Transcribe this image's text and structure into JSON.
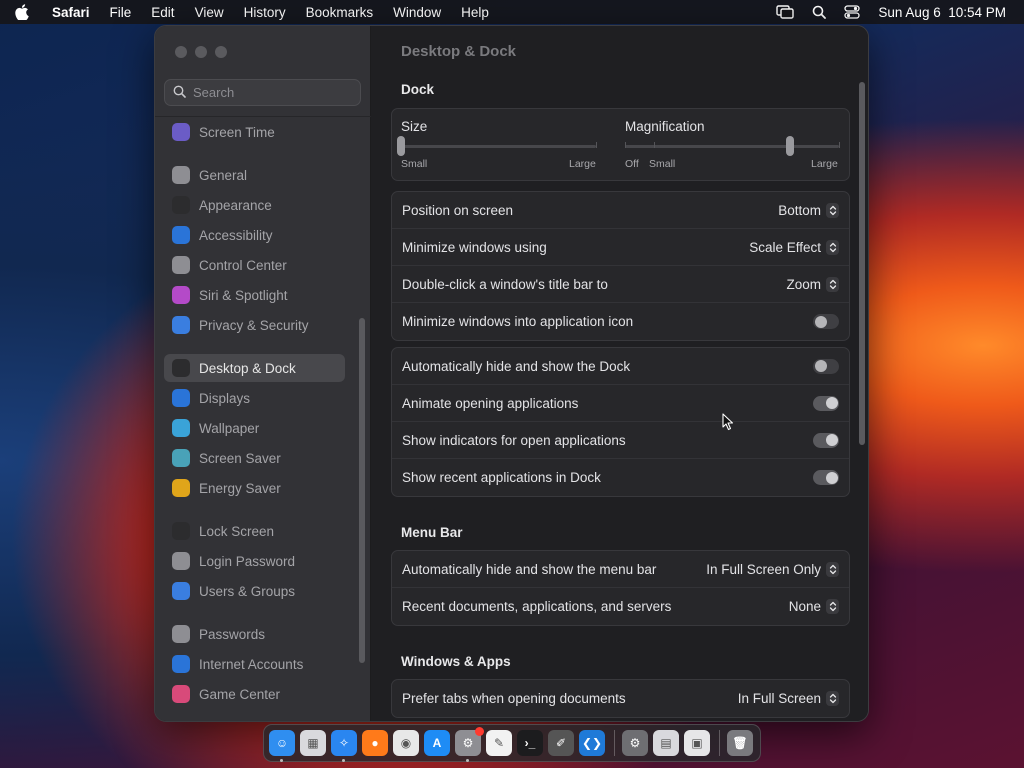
{
  "menubar": {
    "app_name": "Safari",
    "items": [
      "File",
      "Edit",
      "View",
      "History",
      "Bookmarks",
      "Window",
      "Help"
    ],
    "datetime": "Sun Aug 6  10:54 PM"
  },
  "sidebar": {
    "search_placeholder": "Search",
    "items": [
      {
        "label": "Screen Time",
        "icon": "hourglass-icon",
        "color": "#6b5cc6"
      },
      {
        "label": "General",
        "icon": "gear-icon",
        "color": "#8e8e93"
      },
      {
        "label": "Appearance",
        "icon": "appearance-icon",
        "color": "#2c2c2e"
      },
      {
        "label": "Accessibility",
        "icon": "accessibility-icon",
        "color": "#2a74d8"
      },
      {
        "label": "Control Center",
        "icon": "control-center-icon",
        "color": "#8e8e93"
      },
      {
        "label": "Siri & Spotlight",
        "icon": "siri-icon",
        "color": "#b44ac8"
      },
      {
        "label": "Privacy & Security",
        "icon": "hand-icon",
        "color": "#3a7ee0"
      },
      {
        "label": "Desktop & Dock",
        "icon": "dock-icon",
        "color": "#2c2c2e"
      },
      {
        "label": "Displays",
        "icon": "displays-icon",
        "color": "#2a74d8"
      },
      {
        "label": "Wallpaper",
        "icon": "wallpaper-icon",
        "color": "#3aa3d8"
      },
      {
        "label": "Screen Saver",
        "icon": "screen-saver-icon",
        "color": "#49a2b8"
      },
      {
        "label": "Energy Saver",
        "icon": "battery-icon",
        "color": "#e0a51a"
      },
      {
        "label": "Lock Screen",
        "icon": "lock-icon",
        "color": "#2c2c2e"
      },
      {
        "label": "Login Password",
        "icon": "login-password-icon",
        "color": "#8e8e93"
      },
      {
        "label": "Users & Groups",
        "icon": "users-icon",
        "color": "#3a7ee0"
      },
      {
        "label": "Passwords",
        "icon": "key-icon",
        "color": "#8e8e93"
      },
      {
        "label": "Internet Accounts",
        "icon": "at-icon",
        "color": "#2a74d8"
      },
      {
        "label": "Game Center",
        "icon": "game-center-icon",
        "color": "#d84a7a"
      }
    ]
  },
  "main": {
    "title": "Desktop & Dock",
    "dock_section": "Dock",
    "size_label": "Size",
    "size_small": "Small",
    "size_large": "Large",
    "size_value": 0.0,
    "magnification_label": "Magnification",
    "mag_off": "Off",
    "mag_small": "Small",
    "mag_large": "Large",
    "mag_value": 0.77,
    "settings": [
      {
        "label": "Position on screen",
        "value": "Bottom"
      },
      {
        "label": "Minimize windows using",
        "value": "Scale Effect"
      },
      {
        "label": "Double-click a window's title bar to",
        "value": "Zoom"
      },
      {
        "label": "Minimize windows into application icon",
        "toggle": false
      }
    ],
    "dock_toggles": [
      {
        "label": "Automatically hide and show the Dock",
        "toggle": false
      },
      {
        "label": "Animate opening applications",
        "toggle": true
      },
      {
        "label": "Show indicators for open applications",
        "toggle": true
      },
      {
        "label": "Show recent applications in Dock",
        "toggle": true
      }
    ],
    "menubar_section": "Menu Bar",
    "menubar_settings": [
      {
        "label": "Automatically hide and show the menu bar",
        "value": "In Full Screen Only"
      },
      {
        "label": "Recent documents, applications, and servers",
        "value": "None"
      }
    ],
    "windows_section": "Windows & Apps",
    "windows_settings": [
      {
        "label": "Prefer tabs when opening documents",
        "value": "In Full Screen"
      }
    ]
  },
  "dock": {
    "apps": [
      {
        "name": "Finder",
        "icon": "finder-icon",
        "color": "#2f8ef0",
        "running": true
      },
      {
        "name": "Launchpad",
        "icon": "launchpad-icon",
        "color": "#d9d9dd",
        "running": false
      },
      {
        "name": "Safari",
        "icon": "safari-icon",
        "color": "#2a86f0",
        "running": true
      },
      {
        "name": "Firefox",
        "icon": "firefox-icon",
        "color": "#ff7a1a",
        "running": false
      },
      {
        "name": "Chrome",
        "icon": "chrome-icon",
        "color": "#e8e8e8",
        "running": false
      },
      {
        "name": "App Store",
        "icon": "app-store-icon",
        "color": "#1e8cf5",
        "running": false
      },
      {
        "name": "System Settings",
        "icon": "settings-icon",
        "color": "#8e8e93",
        "running": true
      },
      {
        "name": "TextEdit",
        "icon": "textedit-icon",
        "color": "#f2f2f2",
        "running": false
      },
      {
        "name": "Terminal",
        "icon": "terminal-icon",
        "color": "#1c1c1e",
        "running": false
      },
      {
        "name": "Brush",
        "icon": "brush-icon",
        "color": "#555",
        "running": false
      },
      {
        "name": "VS Code",
        "icon": "vscode-icon",
        "color": "#1f7ad8",
        "running": false
      }
    ],
    "others": [
      {
        "name": "Settings",
        "icon": "gear-folder-icon",
        "color": "#6e6e72"
      },
      {
        "name": "Printer",
        "icon": "printer-icon",
        "color": "#d9d9dd"
      },
      {
        "name": "Preview",
        "icon": "preview-icon",
        "color": "#e6e6e8"
      },
      {
        "name": "Trash",
        "icon": "trash-icon",
        "color": "#7a7a7e"
      }
    ]
  }
}
